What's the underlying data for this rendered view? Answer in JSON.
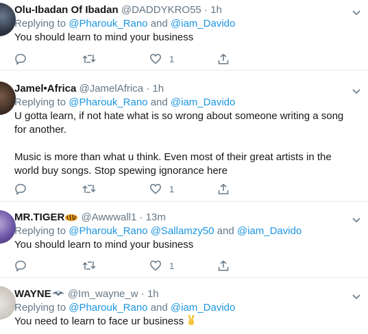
{
  "tweets": [
    {
      "name": "Olu-Ibadan Of Ibadan",
      "handle": "@DADDYKRO55",
      "sep": "·",
      "time": "1h",
      "replying_prefix": "Replying to",
      "mentions": [
        "@Pharouk_Rano",
        "@iam_Davido"
      ],
      "joiner": "and",
      "text": "You should learn to mind your business",
      "likes": "1"
    },
    {
      "name": "Jamel•Africa",
      "handle": "@JamelAfrica",
      "sep": "·",
      "time": "1h",
      "replying_prefix": "Replying to",
      "mentions": [
        "@Pharouk_Rano",
        "@iam_Davido"
      ],
      "joiner": "and",
      "text_p1": "U gotta learn, if not hate what is so wrong about someone writing a song for another.",
      "text_p2": "Music is more than what u think. Even most of their great artists in the world buy songs. Stop spewing ignorance here",
      "likes": "1"
    },
    {
      "name": "MR.TIGER",
      "name_emoji": "tiger-emoji",
      "handle": "@Awwwall1",
      "sep": "·",
      "time": "13m",
      "replying_prefix": "Replying to",
      "mentions": [
        "@Pharouk_Rano",
        "@Sallamzy50",
        "@iam_Davido"
      ],
      "joiner": "and",
      "text": "You should learn to mind your business",
      "likes": "1"
    },
    {
      "name": "WAYNE",
      "name_emoji": "eagle-emoji",
      "handle": "@Im_wayne_w",
      "sep": "·",
      "time": "1h",
      "replying_prefix": "Replying to",
      "mentions": [
        "@Pharouk_Rano",
        "@iam_Davido"
      ],
      "joiner": "and",
      "text": "You need to learn to face ur business",
      "text_emoji": "victory-hand-emoji"
    }
  ],
  "colors": {
    "link": "#1b95e0",
    "muted": "#657786",
    "text": "#14171a",
    "border": "#e6ecf0"
  }
}
